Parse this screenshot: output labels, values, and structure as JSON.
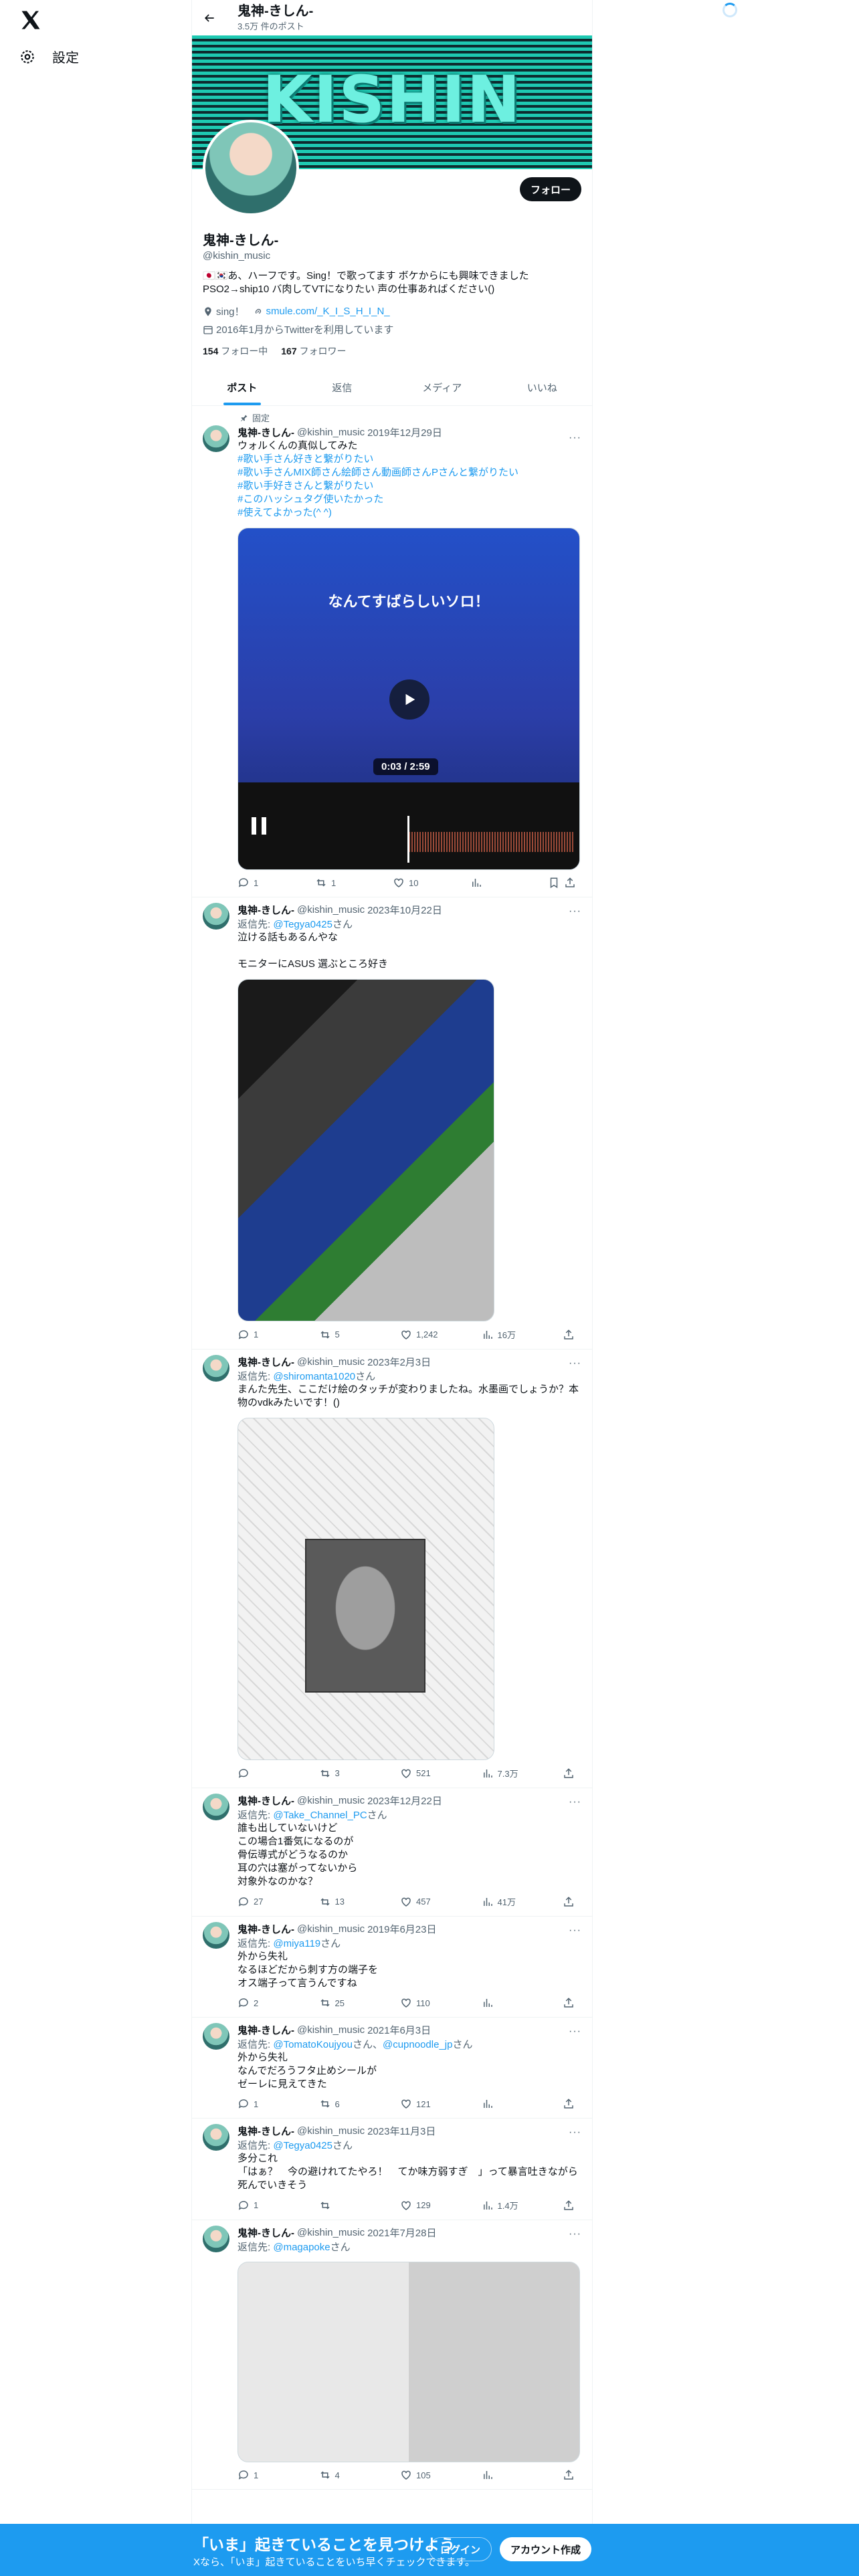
{
  "nav": {
    "settings_label": "設定"
  },
  "header": {
    "title": "鬼神-きしん-",
    "post_count": "3.5万 件のポスト"
  },
  "banner": {
    "text": "KISHIN"
  },
  "profile": {
    "name": "鬼神-きしん-",
    "handle": "@kishin_music",
    "follow_label": "フォロー",
    "bio": "🇯🇵🇰🇷あ、ハーフです。Sing！で歌ってます ボケからにも興味できました PSO2→ship10 バ肉してVTになりたい 声の仕事あればください()",
    "location": "sing！",
    "link": "smule.com/_K_I_S_H_I_N_",
    "joined": "2016年1月からTwitterを利用しています",
    "following_count": "154",
    "following_label": "フォロー中",
    "followers_count": "167",
    "followers_label": "フォロワー"
  },
  "tabs": [
    "ポスト",
    "返信",
    "メディア",
    "いいね"
  ],
  "pinned_label": "固定",
  "posts": [
    {
      "name": "鬼神-きしん-",
      "handle": "@kishin_music",
      "date": "2019年12月29日",
      "text": "ウォルくんの真似してみた",
      "hashtags": [
        "#歌い手さん好きと繋がりたい",
        "#歌い手さんMIX師さん絵師さん動画師さんPさんと繋がりたい",
        "#歌い手好きさんと繋がりたい",
        "#このハッシュタグ使いたかった",
        "#使えてよかった(^ ^)"
      ],
      "video_title": "なんてすばらしいソロ！",
      "video_time": "0:03 / 2:59",
      "replies": "1",
      "reposts": "1",
      "likes": "10",
      "views": ""
    },
    {
      "name": "鬼神-きしん-",
      "handle": "@kishin_music",
      "date": "2023年10月22日",
      "reply_to_prefix": "返信先:",
      "reply_to": "@Tegya0425",
      "reply_to_suffix": "さん",
      "text": "泣ける話もあるんやな\n\nモニターにASUS 選ぶところ好き",
      "replies": "1",
      "reposts": "5",
      "likes": "1,242",
      "views": "16万"
    },
    {
      "name": "鬼神-きしん-",
      "handle": "@kishin_music",
      "date": "2023年2月3日",
      "reply_to_prefix": "返信先:",
      "reply_to": "@shiromanta1020",
      "reply_to_suffix": "さん",
      "text": "まんた先生、ここだけ絵のタッチが変わりましたね。水墨画でしょうか？本物のvdkみたいです！()",
      "replies": "",
      "reposts": "3",
      "likes": "521",
      "views": "7.3万"
    },
    {
      "name": "鬼神-きしん-",
      "handle": "@kishin_music",
      "date": "2023年12月22日",
      "reply_to_prefix": "返信先:",
      "reply_to": "@Take_Channel_PC",
      "reply_to_suffix": "さん",
      "text": "誰も出していないけど\nこの場合1番気になるのが\n骨伝導式がどうなるのか\n耳の穴は塞がってないから\n対象外なのかな？",
      "replies": "27",
      "reposts": "13",
      "likes": "457",
      "views": "41万"
    },
    {
      "name": "鬼神-きしん-",
      "handle": "@kishin_music",
      "date": "2019年6月23日",
      "reply_to_prefix": "返信先:",
      "reply_to": "@miya119",
      "reply_to_suffix": "さん",
      "text": "外から失礼\nなるほどだから刺す方の端子を\nオス端子って言うんですね",
      "replies": "2",
      "reposts": "25",
      "likes": "110",
      "views": ""
    },
    {
      "name": "鬼神-きしん-",
      "handle": "@kishin_music",
      "date": "2021年6月3日",
      "reply_to_prefix": "返信先:",
      "reply_to": "@TomatoKoujyou",
      "reply_to_extra": "@cupnoodle_jp",
      "reply_to_suffix": "さん",
      "text": "外から失礼\nなんでだろうフタ止めシールが\nゼーレに見えてきた",
      "replies": "1",
      "reposts": "6",
      "likes": "121",
      "views": ""
    },
    {
      "name": "鬼神-きしん-",
      "handle": "@kishin_music",
      "date": "2023年11月3日",
      "reply_to_prefix": "返信先:",
      "reply_to": "@Tegya0425",
      "reply_to_suffix": "さん",
      "text": "多分これ\n「はぁ？　今の避けれてたやろ！　てか味方弱すぎ　」って暴言吐きながら死んでいきそう",
      "replies": "1",
      "reposts": "",
      "likes": "129",
      "views": "1.4万"
    },
    {
      "name": "鬼神-きしん-",
      "handle": "@kishin_music",
      "date": "2021年7月28日",
      "reply_to_prefix": "返信先:",
      "reply_to": "@magapoke",
      "reply_to_suffix": "さん",
      "text": "",
      "replies": "1",
      "reposts": "4",
      "likes": "105",
      "views": ""
    }
  ],
  "bottom": {
    "title": "「いま」起きていることを見つけよう",
    "subtitle": "Xなら、「いま」起きていることをいち早くチェックできます。",
    "login_label": "ログイン",
    "signup_label": "アカウント作成"
  }
}
